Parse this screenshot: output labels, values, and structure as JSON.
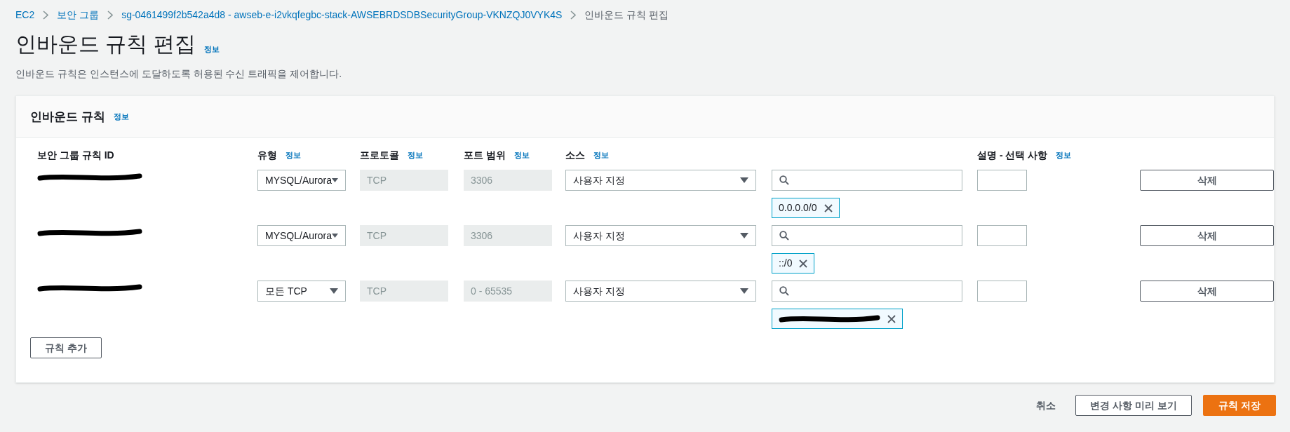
{
  "breadcrumb": [
    "EC2",
    "보안 그룹",
    "sg-0461499f2b542a4d8 - awseb-e-i2vkqfegbc-stack-AWSEBRDSDBSecurityGroup-VKNZQJ0VYK4S",
    "인바운드 규칙 편집"
  ],
  "page": {
    "title": "인바운드 규칙 편집",
    "info": "정보",
    "description": "인바운드 규칙은 인스턴스에 도달하도록 허용된 수신 트래픽을 제어합니다."
  },
  "panel": {
    "title": "인바운드 규칙",
    "info": "정보",
    "columns": [
      {
        "label": "보안 그룹 규칙 ID"
      },
      {
        "label": "유형",
        "info": "정보"
      },
      {
        "label": "프로토콜",
        "info": "정보"
      },
      {
        "label": "포트 범위",
        "info": "정보"
      },
      {
        "label": "소스",
        "info": "정보"
      },
      {
        "label": "설명 - 선택 사항",
        "info": "정보"
      }
    ],
    "rows": [
      {
        "type": "MYSQL/Aurora",
        "protocol": "TCP",
        "port_range": "3306",
        "source_type": "사용자 지정",
        "tag": {
          "kind": "text",
          "label": "0.0.0.0/0"
        },
        "delete": "삭제"
      },
      {
        "type": "MYSQL/Aurora",
        "protocol": "TCP",
        "port_range": "3306",
        "source_type": "사용자 지정",
        "tag": {
          "kind": "text",
          "label": "::/0"
        },
        "delete": "삭제"
      },
      {
        "type": "모든 TCP",
        "protocol": "TCP",
        "port_range": "0 - 65535",
        "source_type": "사용자 지정",
        "tag": {
          "kind": "redacted"
        },
        "delete": "삭제"
      }
    ],
    "add_button": "규칙 추가"
  },
  "footer": {
    "cancel": "취소",
    "preview": "변경 사항 미리 보기",
    "save": "규칙 저장"
  }
}
